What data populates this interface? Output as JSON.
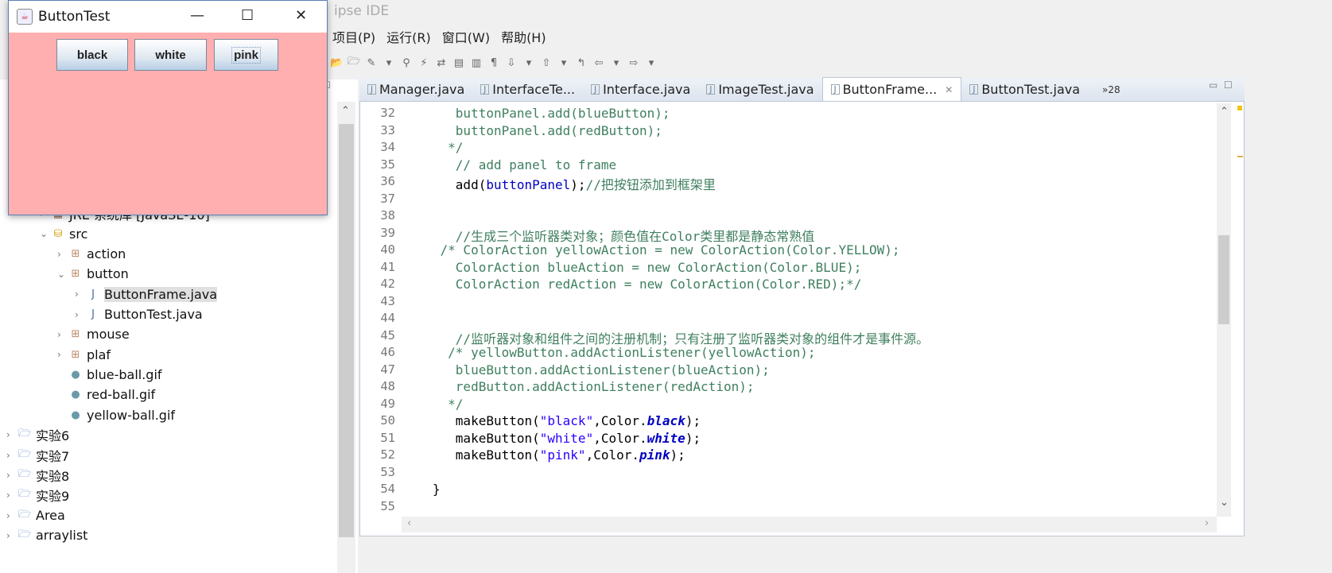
{
  "ide": {
    "title_fragment": "ipse IDE",
    "menu": [
      "项目(P)",
      "运行(R)",
      "窗口(W)",
      "帮助(H)"
    ]
  },
  "tabs": [
    {
      "label": "Manager.java"
    },
    {
      "label": "InterfaceTe..."
    },
    {
      "label": "Interface.java"
    },
    {
      "label": "ImageTest.java"
    },
    {
      "label": "ButtonFrame...",
      "active": true,
      "close": "✕"
    },
    {
      "label": "ButtonTest.java"
    }
  ],
  "tab_overflow": "»28",
  "tree": [
    {
      "label": "JRE 系统库 [JavaSE-10]",
      "depth": 1,
      "twisty": "›",
      "icon": "library-icon"
    },
    {
      "label": "src",
      "depth": 1,
      "twisty": "⌄",
      "icon": "source-folder-icon"
    },
    {
      "label": "action",
      "depth": 2,
      "twisty": "›",
      "icon": "package-icon"
    },
    {
      "label": "button",
      "depth": 2,
      "twisty": "⌄",
      "icon": "package-icon"
    },
    {
      "label": "ButtonFrame.java",
      "depth": 3,
      "twisty": "›",
      "icon": "java-file-icon",
      "selected": true
    },
    {
      "label": "ButtonTest.java",
      "depth": 3,
      "twisty": "›",
      "icon": "java-file-icon"
    },
    {
      "label": "mouse",
      "depth": 2,
      "twisty": "›",
      "icon": "package-icon"
    },
    {
      "label": "plaf",
      "depth": 2,
      "twisty": "›",
      "icon": "package-icon"
    },
    {
      "label": "blue-ball.gif",
      "depth": 2,
      "twisty": "",
      "icon": "image-file-icon"
    },
    {
      "label": "red-ball.gif",
      "depth": 2,
      "twisty": "",
      "icon": "image-file-icon"
    },
    {
      "label": "yellow-ball.gif",
      "depth": 2,
      "twisty": "",
      "icon": "image-file-icon"
    },
    {
      "label": "实验6",
      "depth": 0,
      "twisty": "›",
      "icon": "project-icon"
    },
    {
      "label": "实验7",
      "depth": 0,
      "twisty": "›",
      "icon": "project-icon"
    },
    {
      "label": "实验8",
      "depth": 0,
      "twisty": "›",
      "icon": "project-icon"
    },
    {
      "label": "实验9",
      "depth": 0,
      "twisty": "›",
      "icon": "project-icon"
    },
    {
      "label": "Area",
      "depth": 0,
      "twisty": "›",
      "icon": "project-icon"
    },
    {
      "label": "arraylist",
      "depth": 0,
      "twisty": "›",
      "icon": "project-icon"
    }
  ],
  "code": [
    {
      "n": "32",
      "tokens": [
        [
          "      buttonPanel.add(blueButton);",
          "comment"
        ]
      ]
    },
    {
      "n": "33",
      "tokens": [
        [
          "      buttonPanel.add(redButton);",
          "comment"
        ]
      ]
    },
    {
      "n": "34",
      "tokens": [
        [
          "     */",
          "comment"
        ]
      ]
    },
    {
      "n": "35",
      "tokens": [
        [
          "      // add panel to frame",
          "comment"
        ]
      ]
    },
    {
      "n": "36",
      "tokens": [
        [
          "      add(",
          "plain"
        ],
        [
          "buttonPanel",
          "field"
        ],
        [
          ");",
          "plain"
        ],
        [
          "//把按钮添加到框架里",
          "comment"
        ]
      ]
    },
    {
      "n": "37",
      "tokens": []
    },
    {
      "n": "38",
      "tokens": []
    },
    {
      "n": "39",
      "tokens": [
        [
          "      //生成三个监听器类对象；颜色值在Color类里都是静态常熟值",
          "comment"
        ]
      ]
    },
    {
      "n": "40",
      "tokens": [
        [
          "    /* ColorAction yellowAction = new ColorAction(Color.YELLOW);",
          "comment"
        ]
      ]
    },
    {
      "n": "41",
      "tokens": [
        [
          "      ColorAction blueAction = new ColorAction(Color.BLUE);",
          "comment"
        ]
      ]
    },
    {
      "n": "42",
      "tokens": [
        [
          "      ColorAction redAction = new ColorAction(Color.RED);*/",
          "comment"
        ]
      ]
    },
    {
      "n": "43",
      "tokens": []
    },
    {
      "n": "44",
      "tokens": []
    },
    {
      "n": "45",
      "tokens": [
        [
          "      //监听器对象和组件之间的注册机制；只有注册了监听器类对象的组件才是事件源。",
          "comment"
        ]
      ]
    },
    {
      "n": "46",
      "tokens": [
        [
          "     /* yellowButton.addActionListener(yellowAction);",
          "comment"
        ]
      ]
    },
    {
      "n": "47",
      "tokens": [
        [
          "      blueButton.addActionListener(blueAction);",
          "comment"
        ]
      ]
    },
    {
      "n": "48",
      "tokens": [
        [
          "      redButton.addActionListener(redAction);",
          "comment"
        ]
      ]
    },
    {
      "n": "49",
      "tokens": [
        [
          "     */",
          "comment"
        ]
      ]
    },
    {
      "n": "50",
      "tokens": [
        [
          "      makeButton(",
          "plain"
        ],
        [
          "\"black\"",
          "string"
        ],
        [
          ",Color.",
          "plain"
        ],
        [
          "black",
          "static"
        ],
        [
          ");",
          "plain"
        ]
      ]
    },
    {
      "n": "51",
      "tokens": [
        [
          "      makeButton(",
          "plain"
        ],
        [
          "\"white\"",
          "string"
        ],
        [
          ",Color.",
          "plain"
        ],
        [
          "white",
          "static"
        ],
        [
          ");",
          "plain"
        ]
      ]
    },
    {
      "n": "52",
      "tokens": [
        [
          "      makeButton(",
          "plain"
        ],
        [
          "\"pink\"",
          "string"
        ],
        [
          ",Color.",
          "plain"
        ],
        [
          "pink",
          "static"
        ],
        [
          ");",
          "plain"
        ]
      ]
    },
    {
      "n": "53",
      "tokens": []
    },
    {
      "n": "54",
      "tokens": [
        [
          "   }",
          "plain"
        ]
      ]
    },
    {
      "n": "55",
      "tokens": []
    }
  ],
  "app_window": {
    "title": "ButtonTest",
    "background": "#ffafaf",
    "buttons": [
      "black",
      "white",
      "pink"
    ],
    "minimize": "—",
    "maximize": "☐",
    "close": "✕"
  }
}
